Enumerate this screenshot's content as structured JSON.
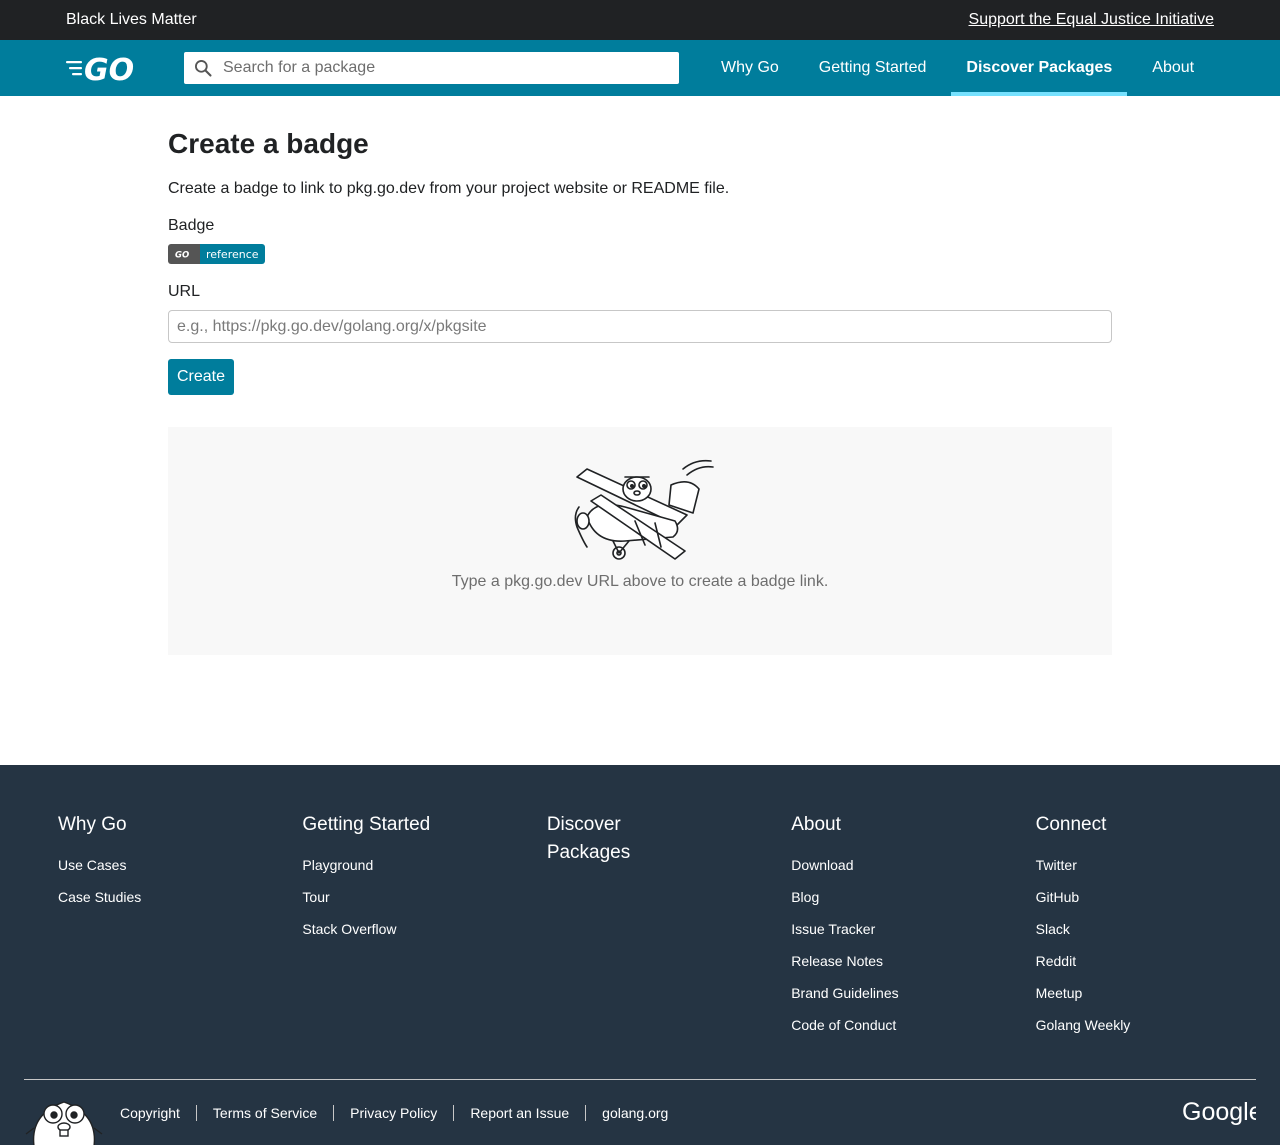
{
  "banner": {
    "text": "Black Lives Matter",
    "link": "Support the Equal Justice Initiative"
  },
  "header": {
    "search_placeholder": "Search for a package",
    "nav": [
      "Why Go",
      "Getting Started",
      "Discover Packages",
      "About"
    ],
    "active_nav": "Discover Packages"
  },
  "main": {
    "title": "Create a badge",
    "description": "Create a badge to link to pkg.go.dev from your project website or README file.",
    "badge_label": "Badge",
    "badge_right": "reference",
    "url_label": "URL",
    "url_placeholder": "e.g., https://pkg.go.dev/golang.org/x/pkgsite",
    "url_value": "",
    "create_button": "Create",
    "empty_message": "Type a pkg.go.dev URL above to create a badge link."
  },
  "footer": {
    "columns": [
      {
        "title": "Why Go",
        "links": [
          "Use Cases",
          "Case Studies"
        ]
      },
      {
        "title": "Getting Started",
        "links": [
          "Playground",
          "Tour",
          "Stack Overflow"
        ]
      },
      {
        "title": "Discover Packages",
        "links": []
      },
      {
        "title": "About",
        "links": [
          "Download",
          "Blog",
          "Issue Tracker",
          "Release Notes",
          "Brand Guidelines",
          "Code of Conduct"
        ]
      },
      {
        "title": "Connect",
        "links": [
          "Twitter",
          "GitHub",
          "Slack",
          "Reddit",
          "Meetup",
          "Golang Weekly"
        ]
      }
    ],
    "bottom_links": [
      "Copyright",
      "Terms of Service",
      "Privacy Policy",
      "Report an Issue",
      "golang.org"
    ],
    "google_logo": "Google"
  },
  "colors": {
    "header_bg": "#007d9c",
    "banner_bg": "#202224",
    "footer_bg": "#253443",
    "active_underline": "#76e1fe"
  },
  "icons": {
    "logo": "go-logo",
    "search": "search-icon",
    "illustration": "gopher-biplane-illustration",
    "footer_mascot": "gopher-icon"
  }
}
